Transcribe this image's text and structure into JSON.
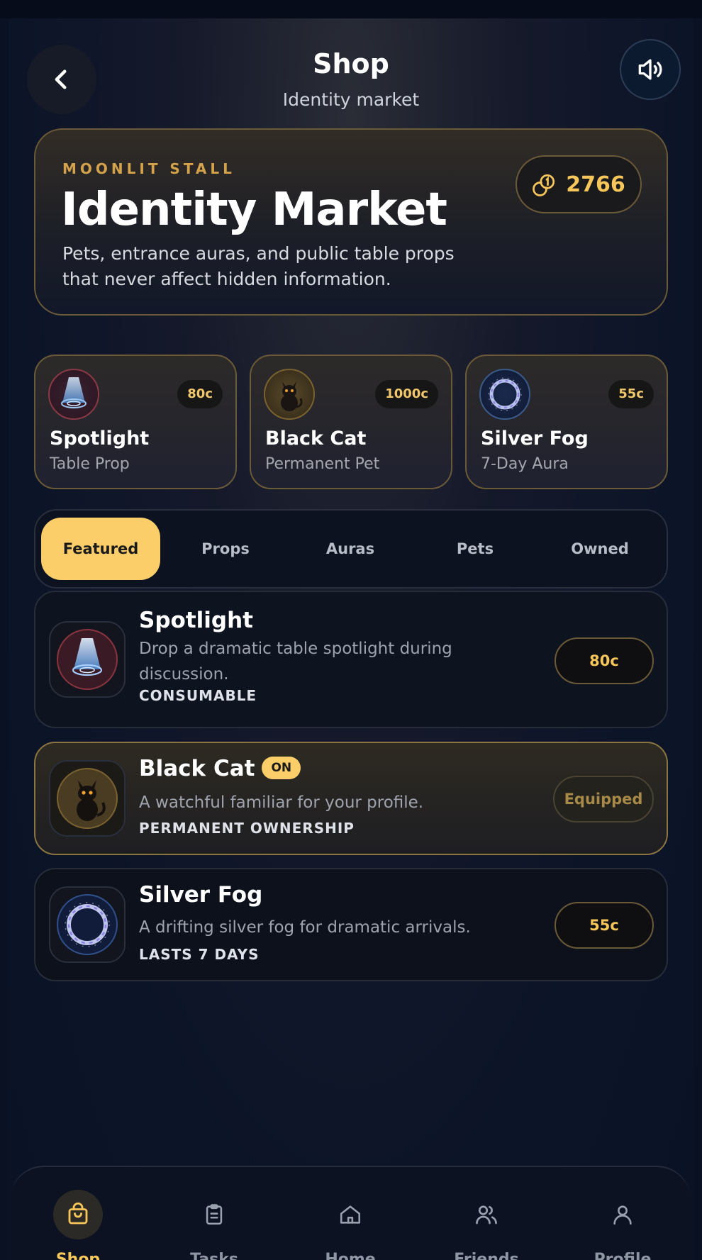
{
  "header": {
    "title": "Shop",
    "subtitle": "Identity market",
    "back_icon": "chevron-left-icon",
    "sound_icon": "speaker-icon"
  },
  "hero": {
    "kicker": "MOONLIT STALL",
    "title": "Identity Market",
    "description": "Pets, entrance auras, and public table props that never affect hidden information.",
    "coins": "2766",
    "coin_icon": "coins-icon"
  },
  "highlights": [
    {
      "name": "Spotlight",
      "subtitle": "Table Prop",
      "price": "80c",
      "icon": "spotlight-icon"
    },
    {
      "name": "Black Cat",
      "subtitle": "Permanent Pet",
      "price": "1000c",
      "icon": "black-cat-icon"
    },
    {
      "name": "Silver Fog",
      "subtitle": "7-Day Aura",
      "price": "55c",
      "icon": "silver-fog-icon"
    }
  ],
  "tabs": [
    {
      "label": "Featured",
      "active": true
    },
    {
      "label": "Props",
      "active": false
    },
    {
      "label": "Auras",
      "active": false
    },
    {
      "label": "Pets",
      "active": false
    },
    {
      "label": "Owned",
      "active": false
    }
  ],
  "items": [
    {
      "name": "Spotlight",
      "description": "Drop a dramatic table spotlight during discussion.",
      "tag": "CONSUMABLE",
      "action": "80c"
    },
    {
      "name": "Black Cat",
      "badge": "ON",
      "description": "A watchful familiar for your profile.",
      "tag": "PERMANENT OWNERSHIP",
      "action": "Equipped"
    },
    {
      "name": "Silver Fog",
      "description": "A drifting silver fog for dramatic arrivals.",
      "tag": "LASTS 7 DAYS",
      "action": "55c"
    }
  ],
  "nav": [
    {
      "label": "Shop",
      "icon": "shopping-bag-icon",
      "active": true
    },
    {
      "label": "Tasks",
      "icon": "clipboard-icon",
      "active": false
    },
    {
      "label": "Home",
      "icon": "home-icon",
      "active": false
    },
    {
      "label": "Friends",
      "icon": "friends-icon",
      "active": false
    },
    {
      "label": "Profile",
      "icon": "profile-icon",
      "active": false
    }
  ],
  "colors": {
    "accent": "#fcce69",
    "gold_text": "#f7c65a",
    "background": "#0a1224",
    "gold_border": "#6a5a37"
  }
}
